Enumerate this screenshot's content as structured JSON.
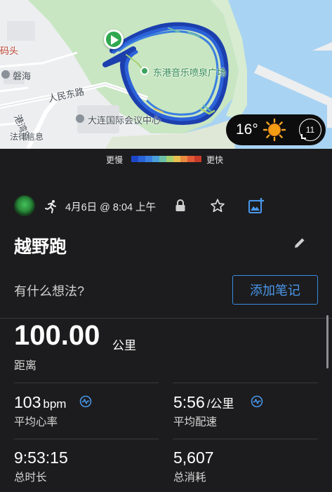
{
  "map": {
    "labels": {
      "wharf": "码头",
      "panhai": "磐海",
      "renmin_road": "人民东路",
      "gangwan_road": "港湾路",
      "convention_center": "大连国际会议中心",
      "fountain_square": "东港音乐喷泉广场",
      "fazhi": "法律信息"
    },
    "weather": {
      "temperature": "16°",
      "wind_speed": "11",
      "icon": "sun-icon"
    }
  },
  "legend": {
    "slow_label": "更慢",
    "fast_label": "更快",
    "colors": [
      "#1e46c8",
      "#2a63d8",
      "#3a7fe0",
      "#4aa0d8",
      "#6cc0a8",
      "#a4d070",
      "#e8c050",
      "#e88a40",
      "#e05a36",
      "#c83a2a"
    ]
  },
  "activity": {
    "avatar_icon": "avatar-icon",
    "type_icon": "running-icon",
    "date": "4月6日 @ 8:04 上午",
    "title": "越野跑",
    "thoughts_placeholder": "有什么想法?",
    "add_note_label": "添加笔记"
  },
  "stats": {
    "distance": {
      "value": "100.00",
      "unit": "公里",
      "label": "距离"
    },
    "avg_hr": {
      "value": "103",
      "unit": "bpm",
      "label": "平均心率"
    },
    "avg_pace": {
      "value": "5:56",
      "unit": "/公里",
      "label": "平均配速"
    },
    "total_time": {
      "value": "9:53:15",
      "label": "总时长"
    },
    "calories": {
      "value": "5,607",
      "label": "总消耗"
    }
  },
  "colors": {
    "accent": "#4a98ec",
    "route": "#2c62d8",
    "background": "#1c1c1e",
    "start": "#2fa84f"
  }
}
